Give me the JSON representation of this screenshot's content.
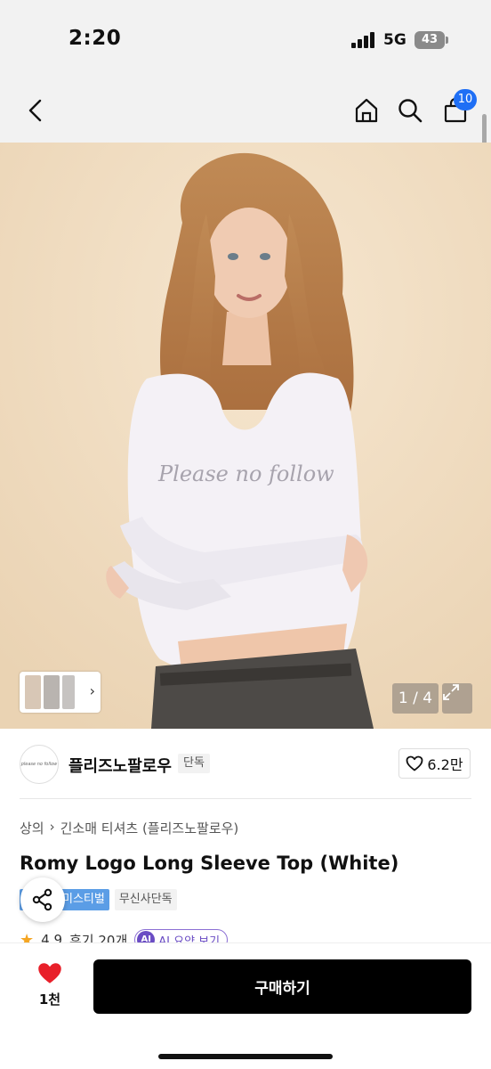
{
  "status_bar": {
    "time": "2:20",
    "network": "5G",
    "battery": "43"
  },
  "nav": {
    "cart_count": "10"
  },
  "hero": {
    "shirt_text": "Please no follow",
    "page_counter": "1 / 4"
  },
  "brand": {
    "name": "플리즈노팔로우",
    "tag": "단독",
    "logo_text": "please no follow",
    "likes": "6.2만"
  },
  "breadcrumb": {
    "category": "상의",
    "subcategory": "긴소매 티셔츠 (플리즈노팔로우)"
  },
  "product": {
    "title": "Romy Logo Long Sleeve Top (White)",
    "tags": [
      "미스티벌",
      "무신사단독"
    ]
  },
  "rating": {
    "score": "4.9",
    "reviews": "후기 20개",
    "ai_badge": "AI",
    "ai_summary": "AI 요약 보기"
  },
  "bottom_bar": {
    "favorite_count": "1천",
    "buy_label": "구매하기"
  },
  "colors": {
    "accent_blue": "#1f6ff5",
    "heart_red": "#e8202a",
    "buy_black": "#000000",
    "festival_blue": "#5b9de6"
  }
}
